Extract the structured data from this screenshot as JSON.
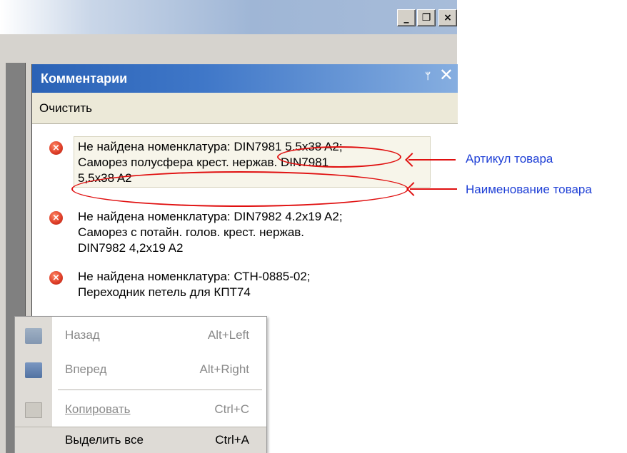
{
  "window": {
    "buttons": {
      "minimize": "_",
      "restore": "❐",
      "close": "×"
    }
  },
  "pane": {
    "title": "Комментарии",
    "pin": "ᛘ",
    "close": "✕",
    "toolbar": {
      "clear_label": "Очистить"
    }
  },
  "messages": [
    {
      "line1": "Не найдена номенклатура: DIN7981 5.5x38 A2;",
      "line2": "Саморез полусфера крест. нержав. DIN7981",
      "line3": "5,5x38 A2"
    },
    {
      "line1": "Не найдена номенклатура: DIN7982 4.2x19 A2;",
      "line2": "Саморез с потайн. голов. крест. нержав.",
      "line3": "DIN7982 4,2x19 A2"
    },
    {
      "line1": "Не найдена номенклатура: СТН-0885-02;",
      "line2": "Переходник петель для КПТ74",
      "line3": ""
    }
  ],
  "annotations": {
    "article": "Артикул товара",
    "name": "Наименование товара"
  },
  "context_menu": {
    "back": {
      "label": "Назад",
      "shortcut": "Alt+Left"
    },
    "forward": {
      "label": "Вперед",
      "shortcut": "Alt+Right"
    },
    "copy": {
      "label": "Копировать",
      "shortcut": "Ctrl+C"
    },
    "select_all": {
      "label": "Выделить все",
      "shortcut": "Ctrl+A"
    }
  },
  "colors": {
    "title_blue": "#2a62b6",
    "annotation_red": "#e01010",
    "label_blue": "#1e3fd6"
  },
  "icons": [
    "error-icon",
    "pin-icon",
    "close-icon",
    "back-icon",
    "forward-icon",
    "copy-icon"
  ]
}
